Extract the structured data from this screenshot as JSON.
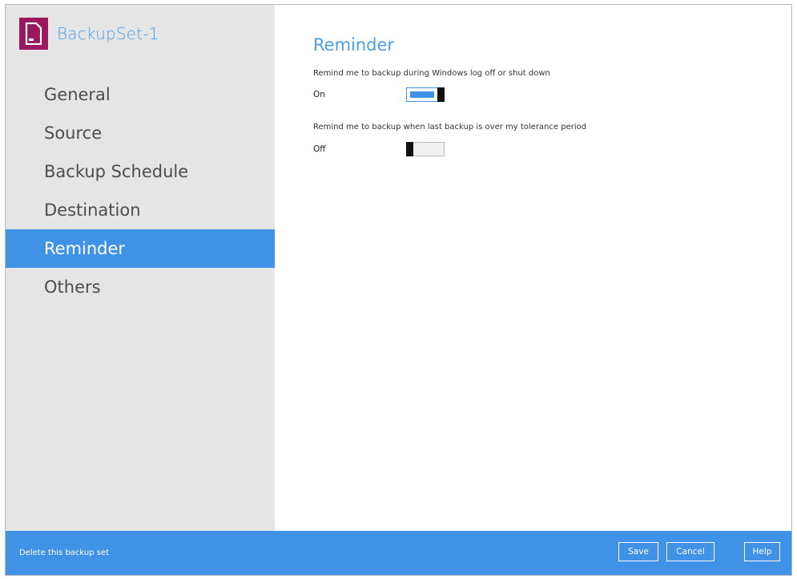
{
  "backupset": {
    "title": "BackupSet-1",
    "icon": "file-icon",
    "icon_color": "#9b1760"
  },
  "sidebar": {
    "items": [
      {
        "label": "General",
        "active": false
      },
      {
        "label": "Source",
        "active": false
      },
      {
        "label": "Backup Schedule",
        "active": false
      },
      {
        "label": "Destination",
        "active": false
      },
      {
        "label": "Reminder",
        "active": true
      },
      {
        "label": "Others",
        "active": false
      }
    ]
  },
  "main": {
    "title": "Reminder",
    "options": [
      {
        "label": "Remind me to backup during Windows log off or shut down",
        "state": "On",
        "enabled": true
      },
      {
        "label": "Remind me to backup when last backup is over my tolerance period",
        "state": "Off",
        "enabled": false
      }
    ]
  },
  "footer": {
    "delete_label": "Delete this backup set",
    "save_label": "Save",
    "cancel_label": "Cancel",
    "help_label": "Help"
  },
  "colors": {
    "accent": "#3f92e6",
    "sidebar_bg": "#e5e5e5",
    "title_text": "#4a9ee6"
  }
}
